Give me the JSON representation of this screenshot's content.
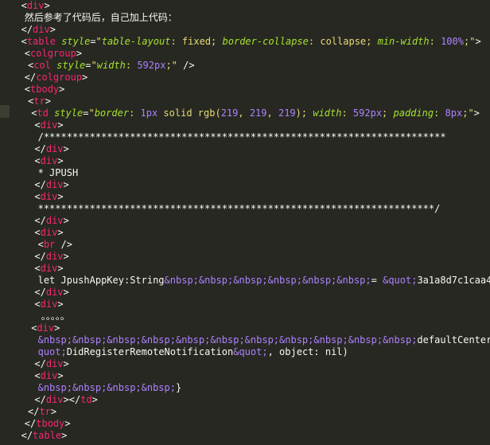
{
  "lines": [
    {
      "indent": 3,
      "parts": [
        {
          "c": "p",
          "t": "<"
        },
        {
          "c": "t",
          "t": "div"
        },
        {
          "c": "p",
          "t": ">"
        }
      ]
    },
    {
      "indent": 4,
      "parts": [
        {
          "c": "p",
          "t": "然后参考了代码后，自己加上代码："
        }
      ]
    },
    {
      "indent": 3,
      "parts": [
        {
          "c": "p",
          "t": "</"
        },
        {
          "c": "t",
          "t": "div"
        },
        {
          "c": "p",
          "t": ">"
        }
      ]
    },
    {
      "indent": 3,
      "parts": [
        {
          "c": "p",
          "t": "<"
        },
        {
          "c": "t",
          "t": "table"
        },
        {
          "c": "p",
          "t": " "
        },
        {
          "c": "a",
          "t": "style"
        },
        {
          "c": "p",
          "t": "="
        },
        {
          "c": "s",
          "t": "\""
        },
        {
          "c": "a",
          "t": "table-layout"
        },
        {
          "c": "s",
          "t": ": fixed; "
        },
        {
          "c": "a",
          "t": "border-collapse"
        },
        {
          "c": "s",
          "t": ": collapse; "
        },
        {
          "c": "a",
          "t": "min-width"
        },
        {
          "c": "s",
          "t": ": "
        },
        {
          "c": "n",
          "t": "100%"
        },
        {
          "c": "s",
          "t": ";\""
        },
        {
          "c": "p",
          "t": ">"
        }
      ]
    },
    {
      "indent": 4,
      "parts": [
        {
          "c": "p",
          "t": "<"
        },
        {
          "c": "t",
          "t": "colgroup"
        },
        {
          "c": "p",
          "t": ">"
        }
      ]
    },
    {
      "indent": 5,
      "parts": [
        {
          "c": "p",
          "t": "<"
        },
        {
          "c": "t",
          "t": "col"
        },
        {
          "c": "p",
          "t": " "
        },
        {
          "c": "a",
          "t": "style"
        },
        {
          "c": "p",
          "t": "="
        },
        {
          "c": "s",
          "t": "\""
        },
        {
          "c": "a",
          "t": "width"
        },
        {
          "c": "s",
          "t": ": "
        },
        {
          "c": "n",
          "t": "592px"
        },
        {
          "c": "s",
          "t": ";\""
        },
        {
          "c": "p",
          "t": " />"
        }
      ]
    },
    {
      "indent": 4,
      "parts": [
        {
          "c": "p",
          "t": "</"
        },
        {
          "c": "t",
          "t": "colgroup"
        },
        {
          "c": "p",
          "t": ">"
        }
      ]
    },
    {
      "indent": 4,
      "parts": [
        {
          "c": "p",
          "t": "<"
        },
        {
          "c": "t",
          "t": "tbody"
        },
        {
          "c": "p",
          "t": ">"
        }
      ]
    },
    {
      "indent": 5,
      "parts": [
        {
          "c": "p",
          "t": "<"
        },
        {
          "c": "t",
          "t": "tr"
        },
        {
          "c": "p",
          "t": ">"
        }
      ]
    },
    {
      "indent": 6,
      "parts": [
        {
          "c": "p",
          "t": "<"
        },
        {
          "c": "t",
          "t": "td"
        },
        {
          "c": "p",
          "t": " "
        },
        {
          "c": "a",
          "t": "style"
        },
        {
          "c": "p",
          "t": "="
        },
        {
          "c": "s",
          "t": "\""
        },
        {
          "c": "a",
          "t": "border"
        },
        {
          "c": "s",
          "t": ": "
        },
        {
          "c": "n",
          "t": "1px"
        },
        {
          "c": "s",
          "t": " solid rgb("
        },
        {
          "c": "n",
          "t": "219"
        },
        {
          "c": "s",
          "t": ", "
        },
        {
          "c": "n",
          "t": "219"
        },
        {
          "c": "s",
          "t": ", "
        },
        {
          "c": "n",
          "t": "219"
        },
        {
          "c": "s",
          "t": "); "
        },
        {
          "c": "a",
          "t": "width"
        },
        {
          "c": "s",
          "t": ": "
        },
        {
          "c": "n",
          "t": "592px"
        },
        {
          "c": "s",
          "t": "; "
        },
        {
          "c": "a",
          "t": "padding"
        },
        {
          "c": "s",
          "t": ": "
        },
        {
          "c": "n",
          "t": "8px"
        },
        {
          "c": "s",
          "t": ";\""
        },
        {
          "c": "p",
          "t": ">"
        }
      ]
    },
    {
      "indent": 7,
      "parts": [
        {
          "c": "p",
          "t": "<"
        },
        {
          "c": "t",
          "t": "div"
        },
        {
          "c": "p",
          "t": ">"
        }
      ]
    },
    {
      "indent": 8,
      "parts": [
        {
          "c": "p",
          "t": "/**********************************************************************"
        }
      ]
    },
    {
      "indent": 7,
      "parts": [
        {
          "c": "p",
          "t": "</"
        },
        {
          "c": "t",
          "t": "div"
        },
        {
          "c": "p",
          "t": ">"
        }
      ]
    },
    {
      "indent": 7,
      "parts": [
        {
          "c": "p",
          "t": "<"
        },
        {
          "c": "t",
          "t": "div"
        },
        {
          "c": "p",
          "t": ">"
        }
      ]
    },
    {
      "indent": 8,
      "parts": [
        {
          "c": "p",
          "t": "* JPUSH"
        }
      ]
    },
    {
      "indent": 7,
      "parts": [
        {
          "c": "p",
          "t": "</"
        },
        {
          "c": "t",
          "t": "div"
        },
        {
          "c": "p",
          "t": ">"
        }
      ]
    },
    {
      "indent": 7,
      "parts": [
        {
          "c": "p",
          "t": "<"
        },
        {
          "c": "t",
          "t": "div"
        },
        {
          "c": "p",
          "t": ">"
        }
      ]
    },
    {
      "indent": 8,
      "parts": [
        {
          "c": "p",
          "t": "*********************************************************************/"
        }
      ]
    },
    {
      "indent": 7,
      "parts": [
        {
          "c": "p",
          "t": "</"
        },
        {
          "c": "t",
          "t": "div"
        },
        {
          "c": "p",
          "t": ">"
        }
      ]
    },
    {
      "indent": 7,
      "parts": [
        {
          "c": "p",
          "t": "<"
        },
        {
          "c": "t",
          "t": "div"
        },
        {
          "c": "p",
          "t": ">"
        }
      ]
    },
    {
      "indent": 8,
      "parts": [
        {
          "c": "p",
          "t": "<"
        },
        {
          "c": "t",
          "t": "br"
        },
        {
          "c": "p",
          "t": " />"
        }
      ]
    },
    {
      "indent": 7,
      "parts": [
        {
          "c": "p",
          "t": "</"
        },
        {
          "c": "t",
          "t": "div"
        },
        {
          "c": "p",
          "t": ">"
        }
      ]
    },
    {
      "indent": 7,
      "parts": [
        {
          "c": "p",
          "t": "<"
        },
        {
          "c": "t",
          "t": "div"
        },
        {
          "c": "p",
          "t": ">"
        }
      ]
    },
    {
      "indent": 8,
      "parts": [
        {
          "c": "p",
          "t": "let JpushAppKey:String"
        },
        {
          "c": "e",
          "t": "&nbsp;&nbsp;&nbsp;&nbsp;&nbsp;&nbsp;"
        },
        {
          "c": "p",
          "t": "= "
        },
        {
          "c": "e",
          "t": "&quot;"
        },
        {
          "c": "p",
          "t": "3a1a8d7c1caa4"
        }
      ]
    },
    {
      "indent": 7,
      "parts": [
        {
          "c": "p",
          "t": "</"
        },
        {
          "c": "t",
          "t": "div"
        },
        {
          "c": "p",
          "t": ">"
        }
      ]
    },
    {
      "indent": 7,
      "parts": [
        {
          "c": "p",
          "t": "<"
        },
        {
          "c": "t",
          "t": "div"
        },
        {
          "c": "p",
          "t": ">"
        }
      ]
    },
    {
      "indent": 9,
      "parts": [
        {
          "c": "p",
          "t": "。。。。。"
        }
      ]
    },
    {
      "indent": 6,
      "parts": [
        {
          "c": "p",
          "t": "<"
        },
        {
          "c": "t",
          "t": "div"
        },
        {
          "c": "p",
          "t": ">"
        }
      ]
    },
    {
      "indent": 8,
      "parts": [
        {
          "c": "e",
          "t": "&nbsp;&nbsp;&nbsp;&nbsp;&nbsp;&nbsp;&nbsp;&nbsp;&nbsp;&nbsp;&nbsp;"
        },
        {
          "c": "p",
          "t": "defaultCenter.addObserver(self, "
        }
      ]
    },
    {
      "indent": 8,
      "parts": [
        {
          "c": "e",
          "t": "quot;"
        },
        {
          "c": "p",
          "t": "DidRegisterRemoteNotification"
        },
        {
          "c": "e",
          "t": "&quot;"
        },
        {
          "c": "p",
          "t": ", object: nil)"
        }
      ]
    },
    {
      "indent": 7,
      "parts": [
        {
          "c": "p",
          "t": "</"
        },
        {
          "c": "t",
          "t": "div"
        },
        {
          "c": "p",
          "t": ">"
        }
      ]
    },
    {
      "indent": 7,
      "parts": [
        {
          "c": "p",
          "t": "<"
        },
        {
          "c": "t",
          "t": "div"
        },
        {
          "c": "p",
          "t": ">"
        }
      ]
    },
    {
      "indent": 8,
      "parts": [
        {
          "c": "e",
          "t": "&nbsp;&nbsp;&nbsp;&nbsp;"
        },
        {
          "c": "p",
          "t": "}"
        }
      ]
    },
    {
      "indent": 7,
      "parts": [
        {
          "c": "p",
          "t": "</"
        },
        {
          "c": "t",
          "t": "div"
        },
        {
          "c": "p",
          "t": "></"
        },
        {
          "c": "t",
          "t": "td"
        },
        {
          "c": "p",
          "t": ">"
        }
      ]
    },
    {
      "indent": 5,
      "parts": [
        {
          "c": "p",
          "t": "</"
        },
        {
          "c": "t",
          "t": "tr"
        },
        {
          "c": "p",
          "t": ">"
        }
      ]
    },
    {
      "indent": 4,
      "parts": [
        {
          "c": "p",
          "t": "</"
        },
        {
          "c": "t",
          "t": "tbody"
        },
        {
          "c": "p",
          "t": ">"
        }
      ]
    },
    {
      "indent": 3,
      "parts": [
        {
          "c": "p",
          "t": "</"
        },
        {
          "c": "t",
          "t": "table"
        },
        {
          "c": "p",
          "t": ">"
        }
      ]
    }
  ]
}
